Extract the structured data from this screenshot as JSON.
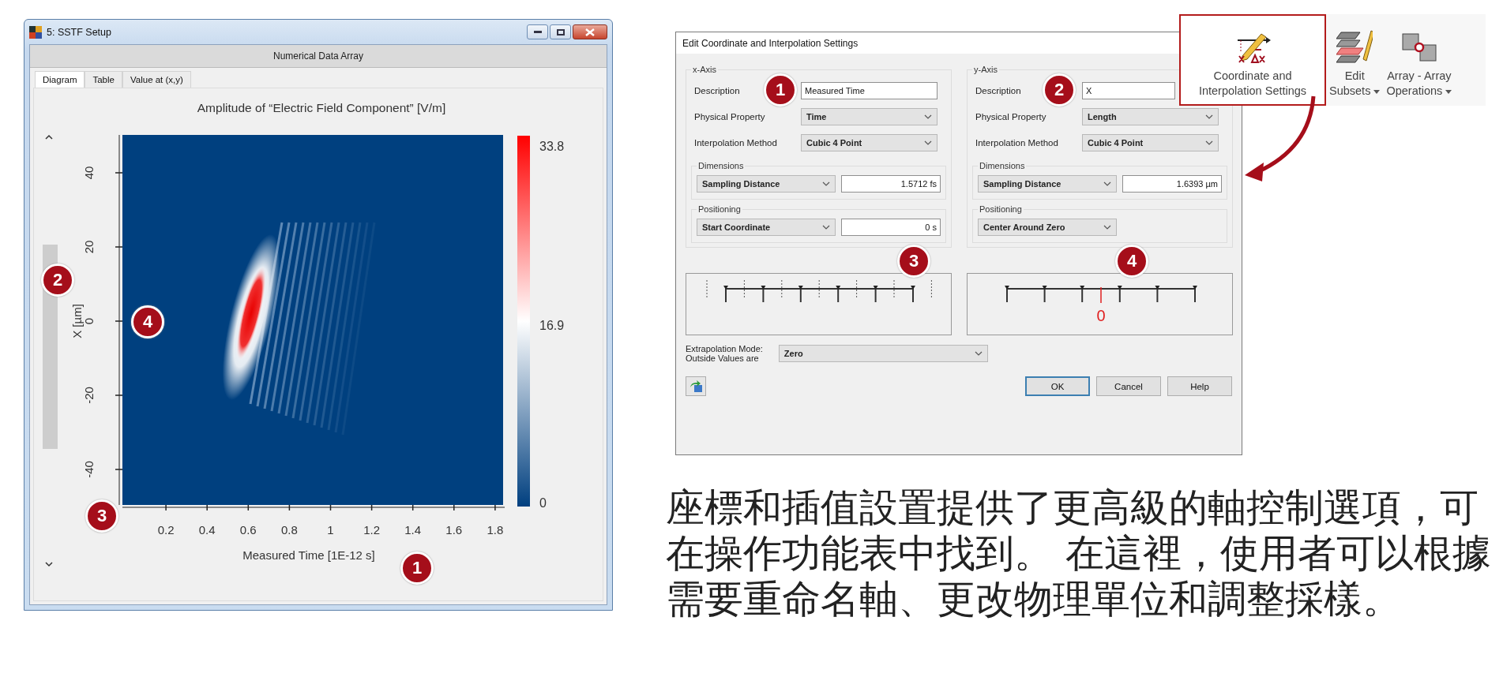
{
  "plot_window": {
    "title": "5: SSTF Setup",
    "header": "Numerical Data Array",
    "tabs": [
      {
        "label": "Diagram",
        "selected": true
      },
      {
        "label": "Table",
        "selected": false
      },
      {
        "label": "Value at (x,y)",
        "selected": false
      }
    ],
    "plot": {
      "title": "Amplitude of “Electric Field Component”  [V/m]",
      "xlabel": "Measured Time [1E-12 s]",
      "ylabel": "X [µm]",
      "xticks": [
        "0.2",
        "0.4",
        "0.6",
        "0.8",
        "1",
        "1.2",
        "1.4",
        "1.6",
        "1.8"
      ],
      "yticks": [
        "40",
        "20",
        "0",
        "-20",
        "-40"
      ],
      "colorbar_labels": [
        "33.8",
        "16.9",
        "0"
      ]
    },
    "markers": [
      "2",
      "4",
      "3",
      "1"
    ]
  },
  "dialog": {
    "title": "Edit Coordinate and Interpolation Settings",
    "axes": [
      {
        "heading": "x-Axis",
        "labels": [
          "Description",
          "Physical Property",
          "Interpolation Method"
        ],
        "description": "Measured Time",
        "physical_property": "Time",
        "interpolation_method": "Cubic 4 Point",
        "dimensions_heading": "Dimensions",
        "dimensions_mode": "Sampling Distance",
        "dimensions_value": "1.5712 fs",
        "positioning_heading": "Positioning",
        "positioning_mode": "Start Coordinate",
        "positioning_value": "0 s"
      },
      {
        "heading": "y-Axis",
        "labels": [
          "Description",
          "Physical Property",
          "Interpolation Method"
        ],
        "description": "X",
        "physical_property": "Length",
        "interpolation_method": "Cubic 4 Point",
        "dimensions_heading": "Dimensions",
        "dimensions_mode": "Sampling Distance",
        "dimensions_value": "1.6393 µm",
        "positioning_heading": "Positioning",
        "positioning_mode": "Center Around Zero"
      }
    ],
    "previews": [
      {
        "kind": "start"
      },
      {
        "kind": "center",
        "zero_label": "0"
      }
    ],
    "extrapolation_label": [
      "Extrapolation Mode:",
      "Outside Values are"
    ],
    "extrapolation_value": "Zero",
    "buttons": [
      {
        "label": "OK",
        "default": true
      },
      {
        "label": "Cancel",
        "default": false
      },
      {
        "label": "Help",
        "default": false
      }
    ],
    "markers": [
      "1",
      "2",
      "3",
      "4"
    ]
  },
  "ribbon": {
    "buttons": [
      {
        "kind": "coordinates",
        "lines": [
          "Coordinate and",
          "Interpolation Settings"
        ],
        "highlighted": true,
        "dropdown": false
      },
      {
        "kind": "subsets",
        "lines": [
          "Edit",
          "Subsets"
        ],
        "highlighted": false,
        "dropdown": true
      },
      {
        "kind": "operations",
        "lines": [
          "Array - Array",
          "Operations"
        ],
        "highlighted": false,
        "dropdown": true
      }
    ]
  },
  "caption": "座標和插值設置提供了更高級的軸控制選項，可在操作功能表中找到。 在這裡，使用者可以根據需要重命名軸、更改物理單位和調整採樣。"
}
